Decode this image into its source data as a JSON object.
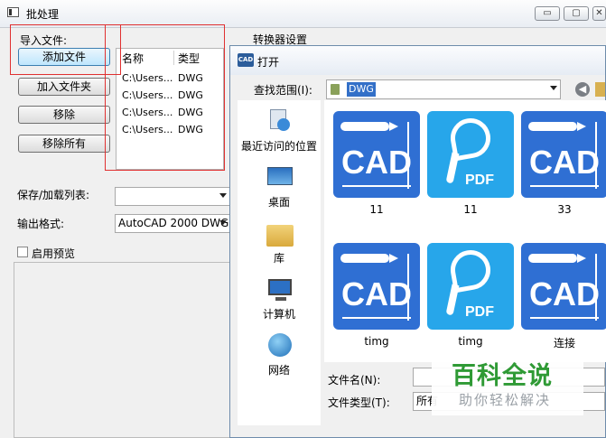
{
  "main_window": {
    "title": "批处理",
    "controls": {
      "minimize": "▭",
      "maximize": "▢",
      "close": "✕"
    },
    "import_label": "导入文件:",
    "buttons": {
      "add_file": "添加文件",
      "add_folder": "加入文件夹",
      "remove": "移除",
      "remove_all": "移除所有"
    },
    "file_table": {
      "columns": [
        "名称",
        "类型"
      ],
      "rows": [
        {
          "name": "C:\\Users...",
          "type": "DWG"
        },
        {
          "name": "C:\\Users...",
          "type": "DWG"
        },
        {
          "name": "C:\\Users...",
          "type": "DWG"
        },
        {
          "name": "C:\\Users...",
          "type": "DWG"
        }
      ]
    },
    "converter_settings_label": "转换器设置",
    "save_load_list_label": "保存/加载列表:",
    "save_load_list_value": "",
    "output_format_label": "输出格式:",
    "output_format_value": "AutoCAD 2000 DWG",
    "enable_preview_label": "启用预览",
    "enable_preview_checked": false
  },
  "open_dialog": {
    "icon_text": "CAD",
    "title": "打开",
    "look_in_label": "查找范围(I):",
    "look_in_value": "DWG",
    "places": [
      {
        "label": "最近访问的位置",
        "icon": "recent-places-icon"
      },
      {
        "label": "桌面",
        "icon": "desktop-icon"
      },
      {
        "label": "库",
        "icon": "library-icon"
      },
      {
        "label": "计算机",
        "icon": "computer-icon"
      },
      {
        "label": "网络",
        "icon": "network-icon"
      }
    ],
    "files": [
      {
        "label": "11",
        "kind": "cad",
        "text": "CAD"
      },
      {
        "label": "11",
        "kind": "pdf",
        "text": "PDF"
      },
      {
        "label": "33",
        "kind": "cad",
        "text": "CAD"
      },
      {
        "label": "timg",
        "kind": "cad",
        "text": "CAD"
      },
      {
        "label": "timg",
        "kind": "pdf",
        "text": "PDF"
      },
      {
        "label": "连接",
        "kind": "cad",
        "text": "CAD"
      }
    ],
    "file_name_label": "文件名(N):",
    "file_name_value": "",
    "file_type_label": "文件类型(T):",
    "file_type_value": "所有"
  },
  "watermark": {
    "main": "百科全说",
    "sub": "助你轻松解决"
  },
  "colors": {
    "highlight_box": "#e03030",
    "cad_blue": "#2f6fd3",
    "pdf_blue": "#27a6ea",
    "watermark_green": "#2f9a35"
  }
}
